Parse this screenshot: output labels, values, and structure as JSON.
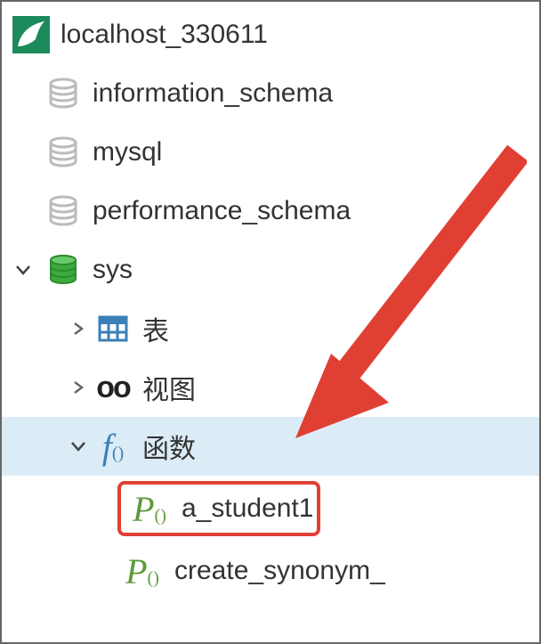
{
  "connection": {
    "name": "localhost_330611"
  },
  "databases": [
    {
      "name": "information_schema",
      "active": false
    },
    {
      "name": "mysql",
      "active": false
    },
    {
      "name": "performance_schema",
      "active": false
    },
    {
      "name": "sys",
      "active": true
    }
  ],
  "sys_children": {
    "tables": {
      "label": "表"
    },
    "views": {
      "label": "视图"
    },
    "functions": {
      "label": "函数"
    }
  },
  "functions_children": [
    {
      "name": "a_student1",
      "highlighted": true
    },
    {
      "name": "create_synonym_",
      "highlighted": false
    }
  ]
}
